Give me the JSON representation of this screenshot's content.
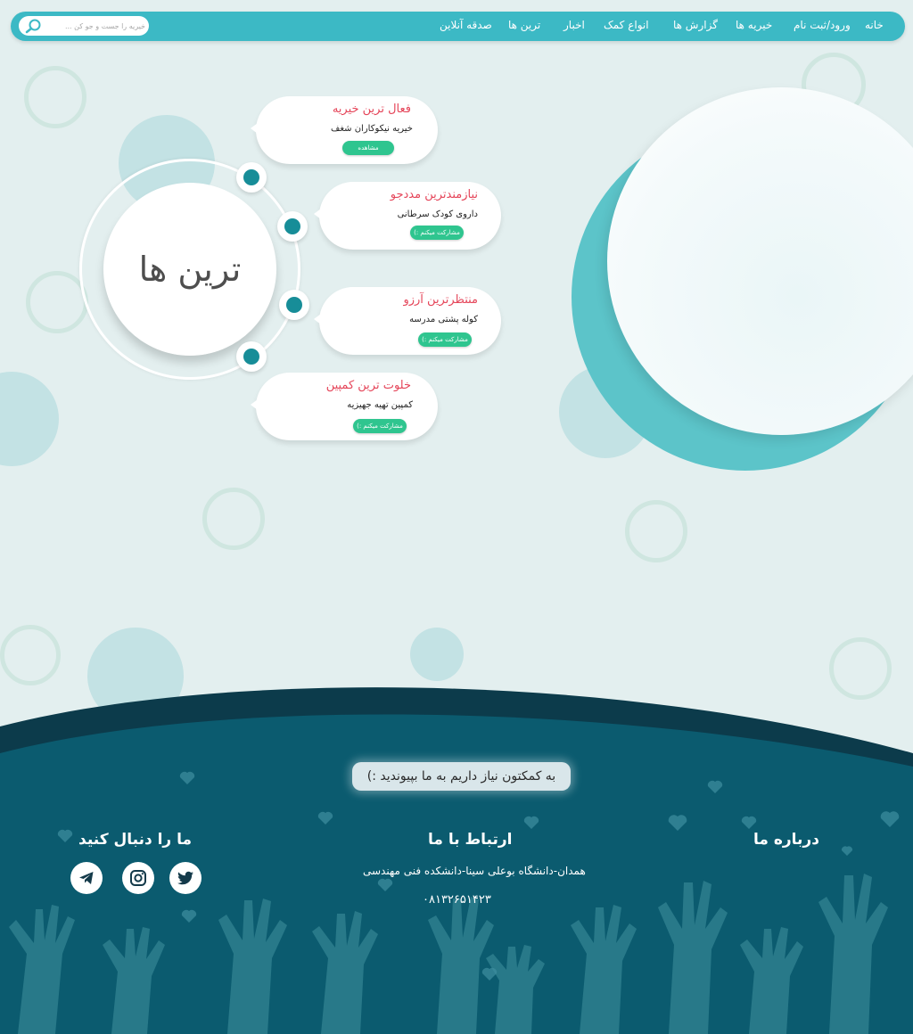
{
  "nav": {
    "items": [
      {
        "label": "خانه"
      },
      {
        "label": "ورود/ثبت نام"
      },
      {
        "label": "خیریه ها"
      },
      {
        "label": "گزارش ها"
      },
      {
        "label": "انواع کمک"
      },
      {
        "label": "اخبار"
      },
      {
        "label": "ترین ها"
      },
      {
        "label": "صدقه آنلاین"
      }
    ],
    "search_placeholder": "خیریه را جست و جو کن ..."
  },
  "hub": {
    "title": "ترین ها"
  },
  "cards": [
    {
      "title": "فعال ترین خیریه",
      "subtitle": "خیریه نیکوکاران شغف",
      "button": "مشاهده"
    },
    {
      "title": "نیازمندترین مددجو",
      "subtitle": "داروی کودک سرطانی",
      "button": "مشارکت میکنم :)"
    },
    {
      "title": "منتظرترین آرزو",
      "subtitle": "کوله پشتی مدرسه",
      "button": "مشارکت میکنم :)"
    },
    {
      "title": "خلوت ترین کمپین",
      "subtitle": "کمپین تهیه جهیزیه",
      "button": "مشارکت میکنم :)"
    }
  ],
  "footer": {
    "join_text": "به کمکتون نیاز داریم به ما بپیوندید :)",
    "about_title": "درباره ما",
    "contact_title": "ارتباط با ما",
    "address": "همدان-دانشگاه بوعلی سینا-دانشکده فنی مهندسی",
    "phone": "۰۸۱۳۲۶۵۱۴۲۳",
    "follow_title": "ما را دنبال کنید",
    "social_icons": [
      "telegram-icon",
      "instagram-icon",
      "twitter-icon"
    ]
  },
  "colors": {
    "navbar": "#3cb9c5",
    "page_bg": "#e3efef",
    "accent_teal": "#178d98",
    "card_title": "#e5465a",
    "button_green": "#2fc58f",
    "footer_dark": "#0b5b6f"
  }
}
